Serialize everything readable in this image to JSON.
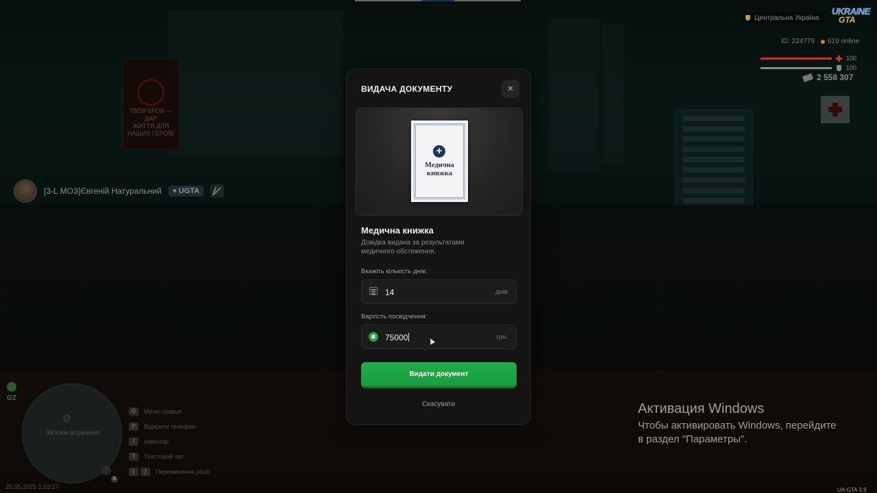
{
  "modal": {
    "title": "ВИДАЧА ДОКУМЕНТУ",
    "close_label": "×",
    "document_preview": {
      "title_line1": "Медична",
      "title_line2": "книжка",
      "plus": "+"
    },
    "document_name": "Медична книжка",
    "document_description": "Довідка видана за результатами медичного обстеження.",
    "days_field": {
      "label": "Вкажіть кількість днів:",
      "value": "14",
      "suffix": "днів"
    },
    "price_field": {
      "label": "Вартість посвідчення:",
      "value": "75000",
      "suffix": "грн.",
      "currency_symbol": "₴"
    },
    "issue_button": "Видати документ",
    "cancel_button": "Скасувати"
  },
  "hud": {
    "region": "Центральна Україна",
    "logo_line1": "UKRAINE",
    "logo_line2": "GTA",
    "player_id": "ID: 224779",
    "online": "619 online",
    "health": 100,
    "armor": 100,
    "health_label": "100",
    "armor_label": "100",
    "money": "2 558 307",
    "gz_label": "GZ",
    "minimap_text": "Зв'язок втрачено",
    "datetime": "25.05.2025 1:18:37",
    "version": "UA-GTA 3.9",
    "mic_key": "B"
  },
  "player_tag": {
    "name": "[3-L МОЗ]Євгеній Натуральний",
    "team": "UGTA"
  },
  "hotkeys": [
    {
      "keys": [
        "O"
      ],
      "label": "Меню гравця"
    },
    {
      "keys": [
        "P"
      ],
      "label": "Відкрити телефон"
    },
    {
      "keys": [
        "I"
      ],
      "label": "Інвентар"
    },
    {
      "keys": [
        "T"
      ],
      "label": "Текстовий чат"
    },
    {
      "keys": [
        "[",
        "]"
      ],
      "label": "Перемикання рації"
    }
  ],
  "windows_activation": {
    "title": "Активация Windows",
    "text": "Чтобы активировать Windows, перейдите в раздел \"Параметры\"."
  },
  "colors": {
    "accent_green": "#1fb04a",
    "health_red": "#c33333",
    "armor_gray": "#8a8a8a",
    "modal_bg": "#141414"
  },
  "icons": {
    "close": "close-icon",
    "calendar": "calendar-icon",
    "currency": "hryvnia-coin-icon",
    "money": "money-icon",
    "health": "health-cross-icon",
    "armor": "armor-shield-icon"
  }
}
